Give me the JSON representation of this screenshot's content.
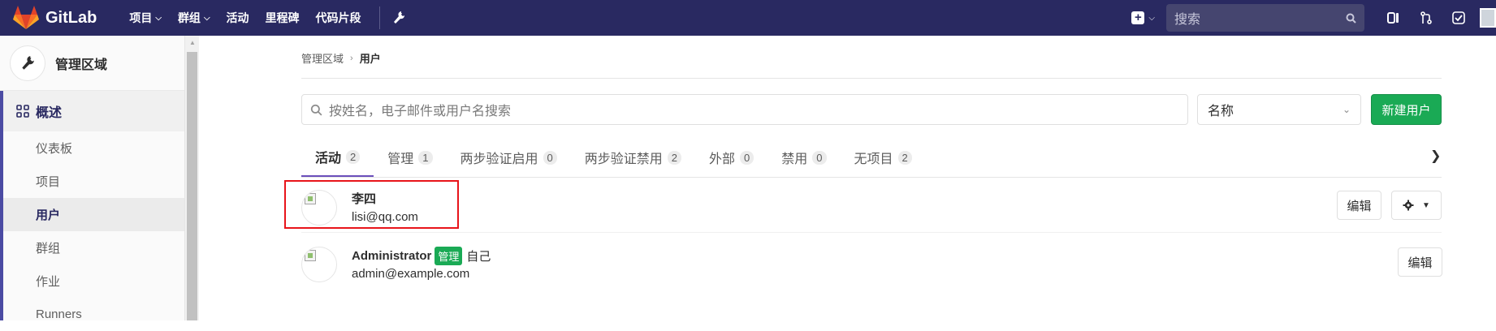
{
  "navbar": {
    "brand": "GitLab",
    "links": [
      {
        "label": "项目",
        "dropdown": true
      },
      {
        "label": "群组",
        "dropdown": true
      },
      {
        "label": "活动",
        "dropdown": false
      },
      {
        "label": "里程碑",
        "dropdown": false
      },
      {
        "label": "代码片段",
        "dropdown": false
      }
    ],
    "search_placeholder": "搜索",
    "brand_color": "#292961"
  },
  "sidebar": {
    "title": "管理区域",
    "section": "概述",
    "items": [
      {
        "label": "仪表板"
      },
      {
        "label": "项目"
      },
      {
        "label": "用户",
        "active": true
      },
      {
        "label": "群组"
      },
      {
        "label": "作业"
      },
      {
        "label": "Runners"
      }
    ]
  },
  "breadcrumb": {
    "parent": "管理区域",
    "current": "用户"
  },
  "filters": {
    "search_placeholder": "按姓名，电子邮件或用户名搜索",
    "sort_value": "名称",
    "new_user_label": "新建用户",
    "new_user_color": "#1aaa55"
  },
  "tabs": [
    {
      "label": "活动",
      "count": "2",
      "active": true
    },
    {
      "label": "管理",
      "count": "1"
    },
    {
      "label": "两步验证启用",
      "count": "0"
    },
    {
      "label": "两步验证禁用",
      "count": "2"
    },
    {
      "label": "外部",
      "count": "0"
    },
    {
      "label": "禁用",
      "count": "0"
    },
    {
      "label": "无项目",
      "count": "2"
    }
  ],
  "users": [
    {
      "name": "李四",
      "email": "lisi@qq.com",
      "edit_label": "编辑"
    },
    {
      "name": "Administrator",
      "badge": "管理",
      "self_label": "自己",
      "email": "admin@example.com",
      "edit_label": "编辑"
    }
  ],
  "highlight_color": "#e8141a"
}
